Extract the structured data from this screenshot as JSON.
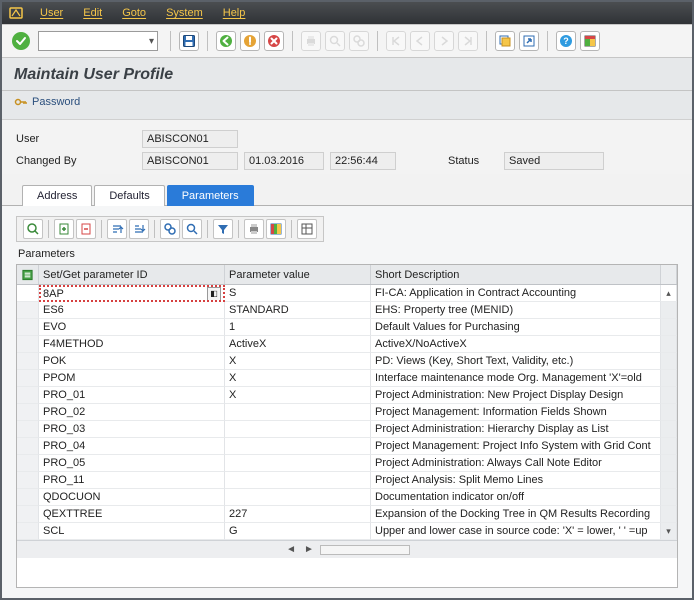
{
  "menubar": {
    "items": [
      "User",
      "Edit",
      "Goto",
      "System",
      "Help"
    ]
  },
  "toolbar": {
    "command_value": ""
  },
  "title": "Maintain User Profile",
  "password_action": "Password",
  "header": {
    "user_label": "User",
    "user_value": "ABISCON01",
    "changed_by_label": "Changed By",
    "changed_by_value": "ABISCON01",
    "changed_date": "01.03.2016",
    "changed_time": "22:56:44",
    "status_label": "Status",
    "status_value": "Saved"
  },
  "tabs": {
    "items": [
      "Address",
      "Defaults",
      "Parameters"
    ],
    "active_index": 2
  },
  "param_section_label": "Parameters",
  "columns": {
    "sel": "",
    "id": "Set/Get parameter ID",
    "value": "Parameter value",
    "desc": "Short Description"
  },
  "rows": [
    {
      "id": "8AP",
      "value": "S",
      "desc": "FI-CA: Application in Contract Accounting",
      "active": true
    },
    {
      "id": "ES6",
      "value": "STANDARD",
      "desc": "EHS: Property tree (MENID)"
    },
    {
      "id": "EVO",
      "value": "1",
      "desc": "Default Values for Purchasing"
    },
    {
      "id": "F4METHOD",
      "value": "ActiveX",
      "desc": "ActiveX/NoActiveX"
    },
    {
      "id": "POK",
      "value": "X",
      "desc": "PD: Views (Key, Short Text, Validity, etc.)"
    },
    {
      "id": "PPOM",
      "value": "X",
      "desc": "Interface maintenance mode Org. Management 'X'=old"
    },
    {
      "id": "PRO_01",
      "value": "X",
      "desc": "Project Administration: New Project Display Design"
    },
    {
      "id": "PRO_02",
      "value": "",
      "desc": "Project Management: Information Fields Shown"
    },
    {
      "id": "PRO_03",
      "value": "",
      "desc": "Project Administration: Hierarchy Display as List"
    },
    {
      "id": "PRO_04",
      "value": "",
      "desc": "Project Management: Project Info System with Grid Cont"
    },
    {
      "id": "PRO_05",
      "value": "",
      "desc": "Project Administration: Always Call Note Editor"
    },
    {
      "id": "PRO_11",
      "value": "",
      "desc": "Project Analysis: Split Memo Lines"
    },
    {
      "id": "QDOCUON",
      "value": "",
      "desc": "Documentation indicator on/off"
    },
    {
      "id": "QEXTTREE",
      "value": "227",
      "desc": "Expansion of the Docking Tree in QM Results Recording"
    },
    {
      "id": "SCL",
      "value": "G",
      "desc": "Upper and lower case in source code: 'X' = lower, ' ' =up"
    }
  ]
}
